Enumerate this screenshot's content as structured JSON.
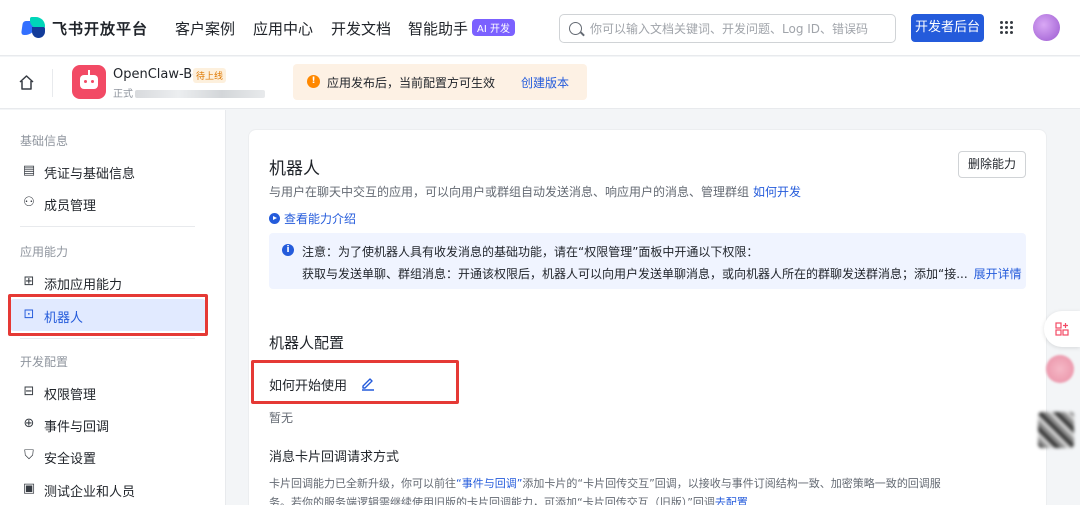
{
  "brand": {
    "name": "飞书开放平台"
  },
  "nav": {
    "items": [
      "客户案例",
      "应用中心",
      "开发文档",
      "智能助手"
    ],
    "ai_badge": "AI 开发",
    "search_placeholder": "你可以输入文档关键词、开发问题、Log ID、错误码",
    "dev_console": "开发者后台"
  },
  "app": {
    "name": "OpenClaw-Bot",
    "status_badge": "待上线",
    "sub_prefix": "正式",
    "notice_text": "应用发布后，当前配置方可生效",
    "notice_link": "创建版本"
  },
  "sidebar": {
    "sections": [
      {
        "title": "基础信息",
        "items": [
          {
            "label": "凭证与基础信息",
            "icon": "credential-icon"
          },
          {
            "label": "成员管理",
            "icon": "member-icon"
          }
        ]
      },
      {
        "title": "应用能力",
        "items": [
          {
            "label": "添加应用能力",
            "icon": "add-capability-icon"
          },
          {
            "label": "机器人",
            "icon": "bot-icon"
          }
        ]
      },
      {
        "title": "开发配置",
        "items": [
          {
            "label": "权限管理",
            "icon": "permission-icon"
          },
          {
            "label": "事件与回调",
            "icon": "event-icon"
          },
          {
            "label": "安全设置",
            "icon": "shield-icon"
          },
          {
            "label": "测试企业和人员",
            "icon": "test-icon"
          }
        ]
      }
    ],
    "active": "机器人"
  },
  "main": {
    "title": "机器人",
    "description": "与用户在聊天中交互的应用，可以向用户或群组自动发送消息、响应用户的消息、管理群组",
    "description_link": "如何开发",
    "delete_button": "删除能力",
    "intro_link": "查看能力介绍",
    "info_line1": "注意：为了使机器人具有收发消息的基础功能，请在“权限管理”面板中开通以下权限：",
    "info_line2": "获取与发送单聊、群组消息：开通该权限后，机器人可以向用户发送单聊消息，或向机器人所在的群聊发送群消息；添加“接...",
    "info_expand": "展开详情",
    "config_title": "机器人配置",
    "how_to_use": "如何开始使用",
    "none_text": "暂无",
    "card_callback_title": "消息卡片回调请求方式",
    "card_callback_p1a": "卡片回调能力已全新升级，你可以前往",
    "card_callback_p1_link": "“事件与回调”",
    "card_callback_p1b": "添加卡片的“卡片回传交互”回调，以接收与事件订阅结构一致、加密策略一致",
    "card_callback_p2a": "的回调服务。若你的服务端逻辑需继续使用旧版的卡片回调能力，可添加“卡片回传交互（旧版）”回调",
    "card_callback_p2_link": "去配置"
  },
  "colors": {
    "accent": "#245bdb",
    "highlight_box": "#e53935",
    "active_bg": "#e1eaff"
  }
}
